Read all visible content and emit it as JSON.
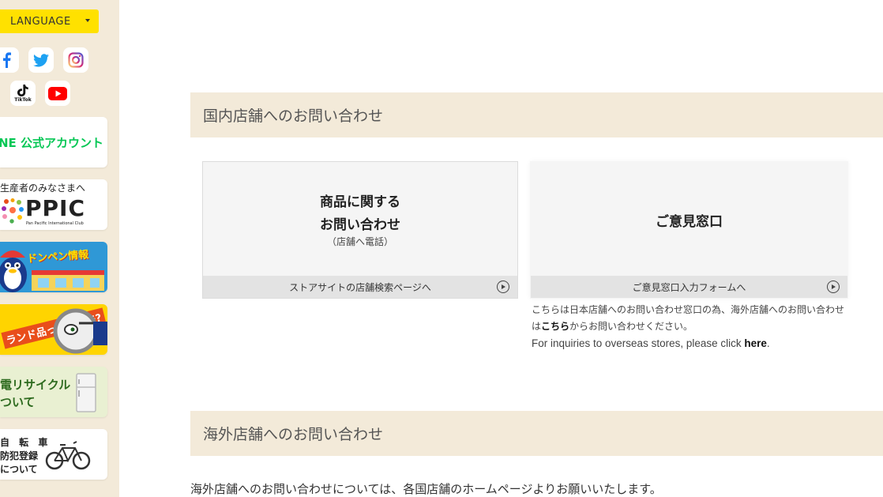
{
  "sidebar": {
    "language_label": "LANGUAGE",
    "line_banner": "NE 公式アカウント",
    "ppic_banner": {
      "sub": "生産者のみなさまへ",
      "big": "PPIC",
      "tiny": "Pan Pacific International Club"
    },
    "donpen_banner": "ドンペン情報",
    "brand_banner": "ランド品って大丈夫?",
    "recycle_banner": {
      "line1": "電リサイクル",
      "line2": "ついて"
    },
    "bike_banner": {
      "line1": "自 転 車",
      "line2": "防犯登録",
      "line3": "について"
    },
    "sns": [
      "facebook-icon",
      "twitter-icon",
      "instagram-icon",
      "tiktok-icon",
      "youtube-icon"
    ],
    "tiktok_label": "TikTok"
  },
  "domestic": {
    "heading": "国内店舗へのお問い合わせ",
    "card1": {
      "title_line1": "商品に関する",
      "title_line2": "お問い合わせ",
      "note": "（店舗へ電話）",
      "link": "ストアサイトの店舗検索ページへ"
    },
    "card2": {
      "title": "ご意見窓口",
      "link": "ご意見窓口入力フォームへ"
    },
    "notice": {
      "jp_part1": "こちらは日本店舗へのお問い合わせ窓口の為、海外店舗へのお問い合わせは",
      "jp_link": "こちら",
      "jp_part2": "からお問い合わせください。",
      "en_part1": "For inquiries to overseas stores, please click ",
      "en_link": "here",
      "en_part2": "."
    }
  },
  "overseas": {
    "heading": "海外店舗へのお問い合わせ",
    "text": "海外店舗へのお問い合わせについては、各国店舗のホームページよりお願いいたします。"
  },
  "colors": {
    "sidebar_bg": "#f3ead9",
    "language_btn": "#ffe100",
    "line_green": "#06c755",
    "section_bg": "#f3ead9",
    "card_bg": "#f5f5f5",
    "card_footer": "#e3e3e3"
  }
}
